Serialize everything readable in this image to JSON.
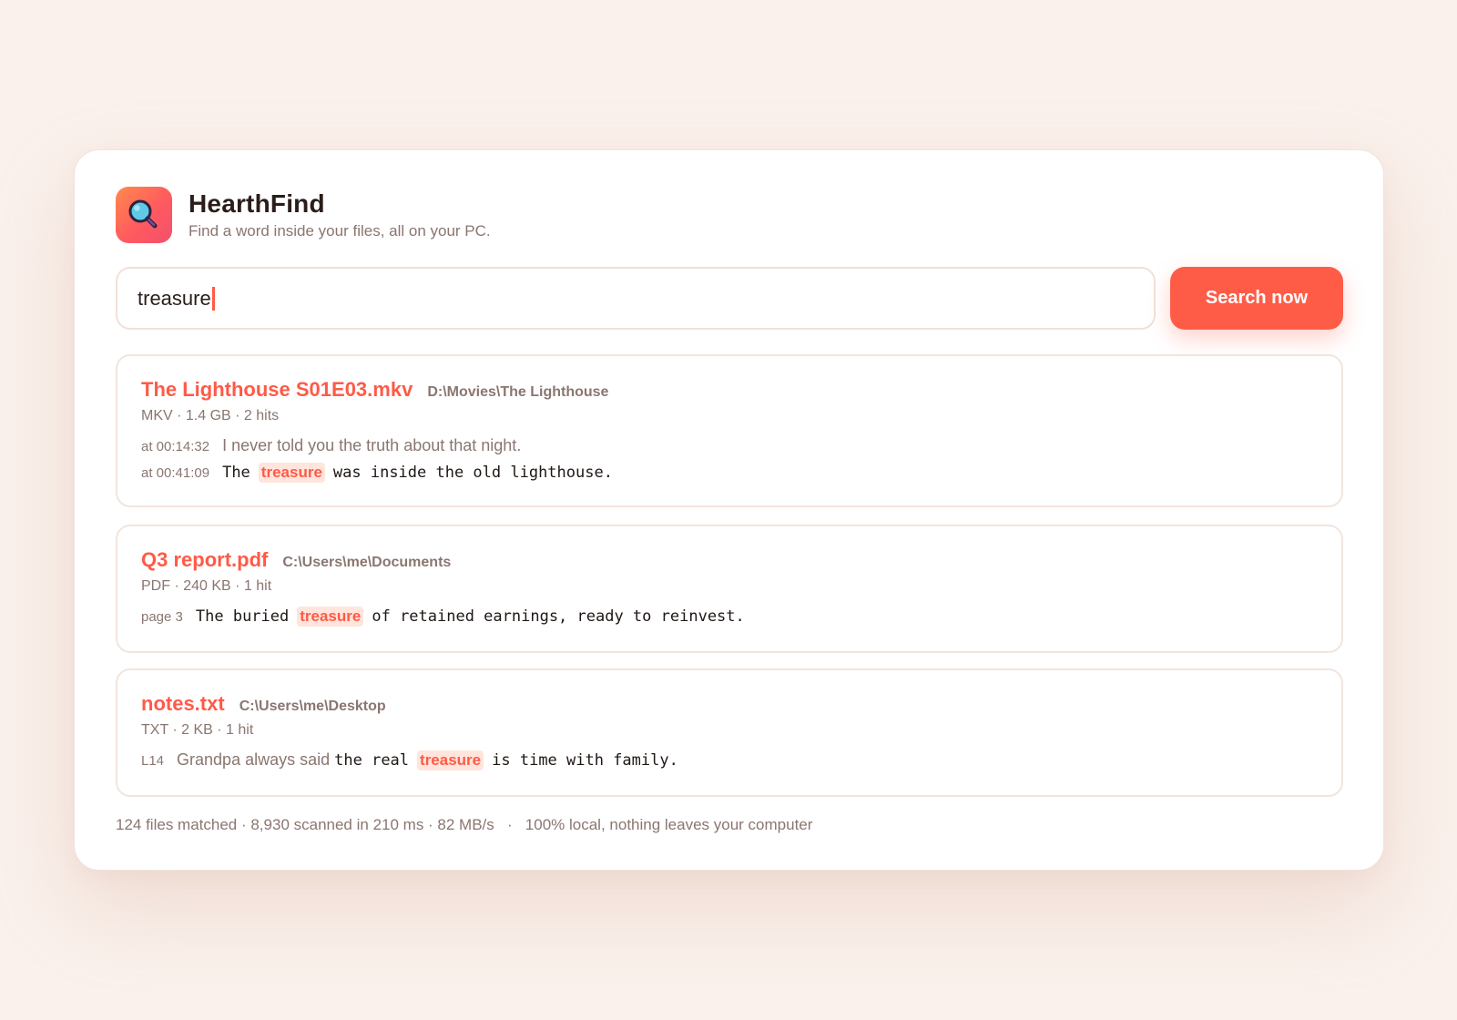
{
  "app": {
    "title": "HearthFind",
    "subtitle": "Find a word inside your files, all on your PC.",
    "logo_icon": "magnifier-icon"
  },
  "search": {
    "value": "treasure",
    "button_label": "Search now"
  },
  "results": [
    {
      "name": "The Lighthouse S01E03.mkv",
      "path": "D:\\Movies\\The Lighthouse",
      "meta": "MKV · 1.4 GB · 2 hits",
      "snippets": [
        {
          "loc": "at 00:14:32",
          "before": "I never told you the truth about that night.",
          "match": "",
          "after": ""
        },
        {
          "loc": "at 00:41:09",
          "before": "The",
          "match": "treasure",
          "after": "was inside the old lighthouse."
        }
      ]
    },
    {
      "name": "Q3 report.pdf",
      "path": "C:\\Users\\me\\Documents",
      "meta": "PDF · 240 KB · 1 hit",
      "snippets": [
        {
          "loc": "page 3",
          "before": "The buried",
          "match": "treasure",
          "after": "of retained earnings, ready to reinvest."
        }
      ]
    },
    {
      "name": "notes.txt",
      "path": "C:\\Users\\me\\Desktop",
      "meta": "TXT · 2 KB · 1 hit",
      "snippets": [
        {
          "loc": "L14",
          "lead": "Grandpa always said",
          "before": "the real",
          "match": "treasure",
          "after": "is time with family."
        }
      ]
    }
  ],
  "footer": {
    "stats": "124 files matched · 8,930 scanned in 210 ms · 82 MB/s",
    "separator": "·",
    "privacy": "100% local, nothing leaves your computer"
  },
  "colors": {
    "accent": "#ff5c47",
    "highlight_bg": "#ffe5dc",
    "background": "#faf1ec"
  }
}
